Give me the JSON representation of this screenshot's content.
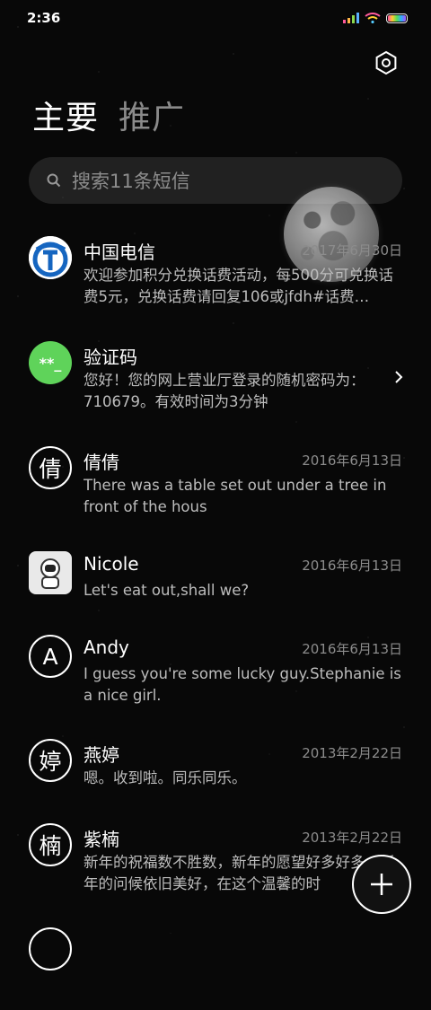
{
  "status": {
    "time": "2:36"
  },
  "tabs": [
    {
      "label": "主要"
    },
    {
      "label": "推广"
    }
  ],
  "search": {
    "placeholder": "搜索11条短信"
  },
  "messages": [
    {
      "name": "中国电信",
      "date": "2017年6月30日",
      "preview": "欢迎参加积分兑换话费活动，每500分可兑换话费5元，兑换话费请回复106或jfdh#话费…",
      "avatar_type": "telecom-logo"
    },
    {
      "name": "验证码",
      "date": "",
      "preview": "您好！您的网上营业厅登录的随机密码为：710679。有效时间为3分钟",
      "avatar_type": "code",
      "avatar_text": "**_"
    },
    {
      "name": "倩倩",
      "date": "2016年6月13日",
      "preview": "There was a table set out under a tree in front of the hous",
      "avatar_type": "letter",
      "avatar_text": "倩"
    },
    {
      "name": "Nicole",
      "date": "2016年6月13日",
      "preview": "Let's eat out,shall we?",
      "avatar_type": "photo"
    },
    {
      "name": "Andy",
      "date": "2016年6月13日",
      "preview": "I guess you're some lucky guy.Stephanie is a nice girl.",
      "avatar_type": "letter",
      "avatar_text": "A"
    },
    {
      "name": "燕婷",
      "date": "2013年2月22日",
      "preview": "嗯。收到啦。同乐同乐。",
      "avatar_type": "letter",
      "avatar_text": "婷"
    },
    {
      "name": "紫楠",
      "date": "2013年2月22日",
      "preview": "新年的祝福数不胜数，新年的愿望好多好多，新年的问候依旧美好，在这个温馨的时",
      "avatar_type": "letter",
      "avatar_text": "楠"
    }
  ],
  "colors": {
    "background": "#080808",
    "code_avatar": "#5fd35a",
    "telecom_blue": "#1565c0"
  }
}
